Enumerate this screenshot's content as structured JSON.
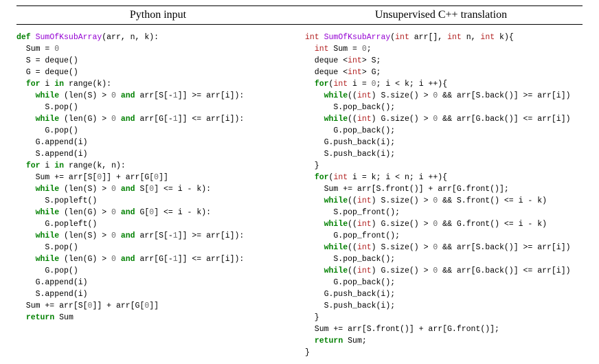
{
  "headers": {
    "left": "Python input",
    "right": "Unsupervised C++ translation"
  },
  "python": {
    "kw_def": "def",
    "fn_name": "SumOfKsubArray",
    "sig_rest": "(arr, n, k):",
    "l2": "  Sum = ",
    "l2n": "0",
    "l3": "  S = deque()",
    "l4": "  G = deque()",
    "kw_for": "for",
    "kw_in": "in",
    "kw_while": "while",
    "kw_and": "and",
    "kw_return": "return",
    "l5a": "  ",
    "l5b": " i ",
    "l5c": " range(k):",
    "l6a": "    ",
    "l6b": " (len(S) > ",
    "l6n": "0",
    "l6c": " ",
    "l6d": " arr[S[-",
    "l6n2": "1",
    "l6e": "]] >= arr[i]):",
    "l7": "      S.pop()",
    "l8a": "    ",
    "l8b": " (len(G) > ",
    "l8c": " arr[G[-",
    "l8e": "]] <= arr[i]):",
    "l9": "      G.pop()",
    "l10": "    G.append(i)",
    "l11": "    S.append(i)",
    "l12a": "  ",
    "l12b": " i ",
    "l12c": " range(k, n):",
    "l13a": "    Sum += arr[S[",
    "l13n": "0",
    "l13b": "]] + arr[G[",
    "l13c": "]]",
    "l14a": "    ",
    "l14b": " (len(S) > ",
    "l14c": " S[",
    "l14d": "] <= i - k):",
    "l15": "      S.popleft()",
    "l16a": "    ",
    "l16b": " (len(G) > ",
    "l16c": " G[",
    "l17": "      G.popleft()",
    "l18a": "    ",
    "l18b": " (len(S) > ",
    "l18c": " arr[S[-",
    "l18d": "]] >= arr[i]):",
    "l19": "      S.pop()",
    "l20a": "    ",
    "l20b": " (len(G) > ",
    "l20c": " arr[G[-",
    "l20d": "]] <= arr[i]):",
    "l21": "      G.pop()",
    "l22": "    G.append(i)",
    "l23": "    S.append(i)",
    "l24a": "  Sum += arr[S[",
    "l24b": "]] + arr[G[",
    "l24c": "]]",
    "l25a": "  ",
    "l25b": " Sum"
  },
  "cpp": {
    "type_int": "int",
    "fn_name": "SumOfKsubArray",
    "sig_a": "(",
    "sig_b": " arr[], ",
    "sig_c": " n, ",
    "sig_d": " k){",
    "l2a": "  ",
    "l2b": " Sum = ",
    "l2n": "0",
    "l2c": ";",
    "l3a": "  deque <",
    "l3b": "> S;",
    "l4a": "  deque <",
    "l4b": "> G;",
    "kw_for": "for",
    "kw_while": "while",
    "kw_return": "return",
    "l5a": "  ",
    "l5b": "(",
    "l5c": " i = ",
    "l5d": "; i < k; i ++){",
    "l6a": "    ",
    "l6b": "((",
    "l6c": ") S.size() > ",
    "l6d": " && arr[S.back()] >= arr[i])",
    "l7": "      S.pop_back();",
    "l8a": "    ",
    "l8b": "((",
    "l8c": ") G.size() > ",
    "l8d": " && arr[G.back()] <= arr[i])",
    "l9": "      G.pop_back();",
    "l10": "    G.push_back(i);",
    "l11": "    S.push_back(i);",
    "l12": "  }",
    "l13a": "  ",
    "l13b": "(",
    "l13c": " i = k; i < n; i ++){",
    "l14": "    Sum += arr[S.front()] + arr[G.front()];",
    "l15a": "    ",
    "l15b": "((",
    "l15c": ") S.size() > ",
    "l15d": " && S.front() <= i - k)",
    "l16": "      S.pop_front();",
    "l17a": "    ",
    "l17b": "((",
    "l17c": ") G.size() > ",
    "l17d": " && G.front() <= i - k)",
    "l18": "      G.pop_front();",
    "l19a": "    ",
    "l19b": "((",
    "l19c": ") S.size() > ",
    "l19d": " && arr[S.back()] >= arr[i])",
    "l20": "      S.pop_back();",
    "l21a": "    ",
    "l21b": "((",
    "l21c": ") G.size() > ",
    "l21d": " && arr[G.back()] <= arr[i])",
    "l22": "      G.pop_back();",
    "l23": "    G.push_back(i);",
    "l24": "    S.push_back(i);",
    "l25": "  }",
    "l26": "  Sum += arr[S.front()] + arr[G.front()];",
    "l27a": "  ",
    "l27b": " Sum;",
    "l28": "}"
  }
}
